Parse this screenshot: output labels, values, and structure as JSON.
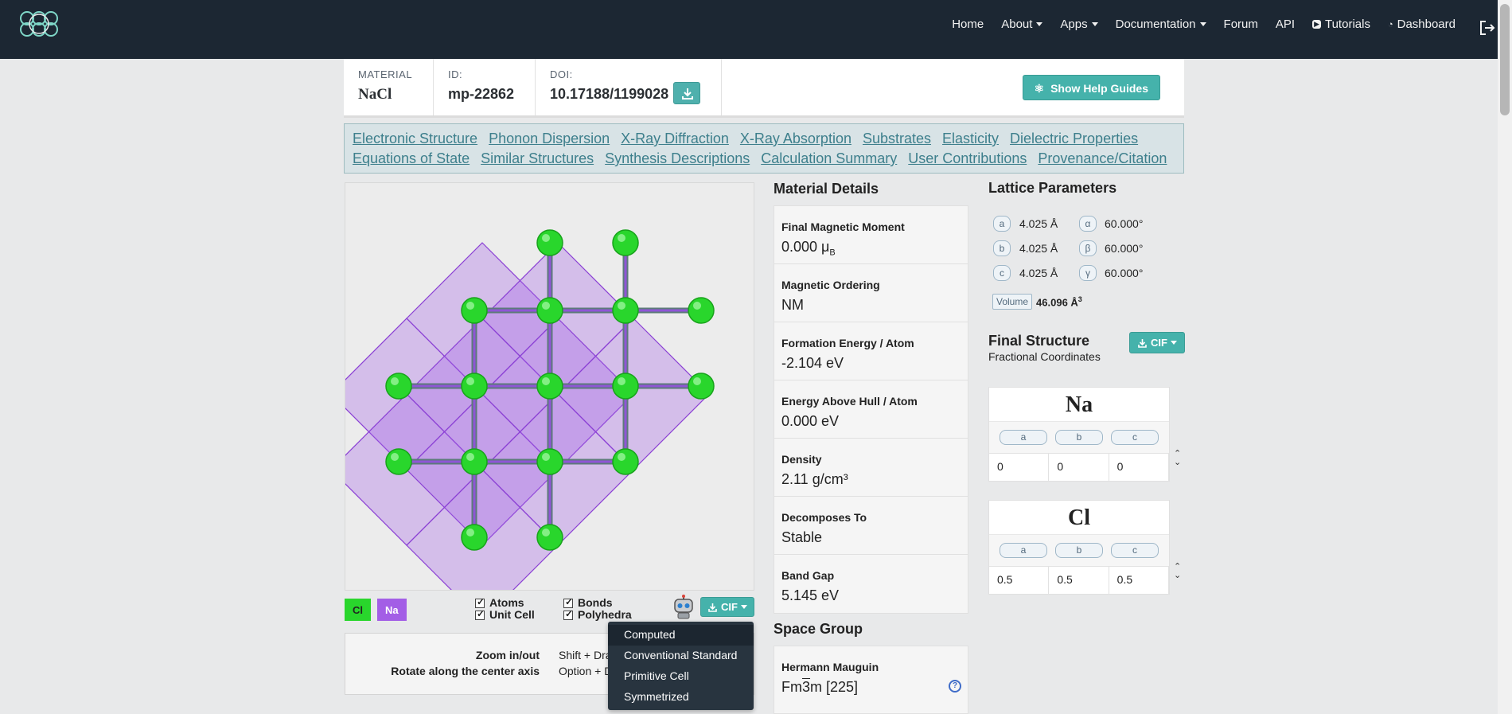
{
  "nav": {
    "links": [
      {
        "label": "Home",
        "caret": false
      },
      {
        "label": "About",
        "caret": true
      },
      {
        "label": "Apps",
        "caret": true
      },
      {
        "label": "Documentation",
        "caret": true
      },
      {
        "label": "Forum",
        "caret": false
      },
      {
        "label": "API",
        "caret": false
      },
      {
        "label": "Tutorials",
        "caret": false,
        "icon": "youtube-icon"
      },
      {
        "label": "Dashboard",
        "caret": false,
        "icon": "dashboard-icon"
      }
    ]
  },
  "header": {
    "material_label": "MATERIAL",
    "material_value": "NaCl",
    "id_label": "ID:",
    "id_value": "mp-22862",
    "doi_label": "DOI:",
    "doi_value": "10.17188/1199028",
    "help_button": "Show Help Guides"
  },
  "tabs": {
    "row1": [
      "Electronic Structure",
      "Phonon Dispersion",
      "X-Ray Diffraction",
      "X-Ray Absorption",
      "Substrates",
      "Elasticity",
      "Dielectric Properties"
    ],
    "row2": [
      "Equations of State",
      "Similar Structures",
      "Synthesis Descriptions",
      "Calculation Summary",
      "User Contributions",
      "Provenance/Citation"
    ]
  },
  "viewer": {
    "legend": [
      {
        "symbol": "Cl",
        "color": "#29d62c"
      },
      {
        "symbol": "Na",
        "color": "#a35ee6"
      }
    ],
    "checkboxes": [
      "Atoms",
      "Bonds",
      "Unit Cell",
      "Polyhedra"
    ],
    "cif_button": "CIF",
    "controls": [
      {
        "action": "Zoom in/out",
        "shortcut": "Shift + Dra"
      },
      {
        "action": "Rotate along the center axis",
        "shortcut": "Option + D"
      }
    ],
    "dropdown": [
      "Computed",
      "Conventional Standard",
      "Primitive Cell",
      "Symmetrized"
    ]
  },
  "details": {
    "title": "Material Details",
    "items": [
      {
        "label": "Final Magnetic Moment",
        "value": "0.000 μ",
        "sub": "B"
      },
      {
        "label": "Magnetic Ordering",
        "value": "NM"
      },
      {
        "label": "Formation Energy / Atom",
        "value": "-2.104 eV"
      },
      {
        "label": "Energy Above Hull / Atom",
        "value": "0.000 eV"
      },
      {
        "label": "Density",
        "value": "2.11 g/cm³"
      },
      {
        "label": "Decomposes To",
        "value": "Stable"
      },
      {
        "label": "Band Gap",
        "value": "5.145 eV"
      }
    ],
    "space_group_title": "Space Group",
    "hm_label": "Hermann Mauguin",
    "hm_value_pre": "Fm",
    "hm_value_bar": "3",
    "hm_value_post": "m [225]"
  },
  "lattice": {
    "title": "Lattice Parameters",
    "rows": [
      {
        "k1": "a",
        "v1": "4.025 Å",
        "k2": "α",
        "v2": "60.000°"
      },
      {
        "k1": "b",
        "v1": "4.025 Å",
        "k2": "β",
        "v2": "60.000°"
      },
      {
        "k1": "c",
        "v1": "4.025 Å",
        "k2": "γ",
        "v2": "60.000°"
      }
    ],
    "volume_label": "Volume",
    "volume_value": "46.096 Å",
    "volume_sup": "3"
  },
  "final_structure": {
    "title": "Final Structure",
    "subtitle": "Fractional Coordinates",
    "cif_button": "CIF",
    "sites": [
      {
        "element": "Na",
        "a": "0",
        "b": "0",
        "c": "0"
      },
      {
        "element": "Cl",
        "a": "0.5",
        "b": "0.5",
        "c": "0.5"
      }
    ],
    "axis_labels": [
      "a",
      "b",
      "c"
    ]
  }
}
